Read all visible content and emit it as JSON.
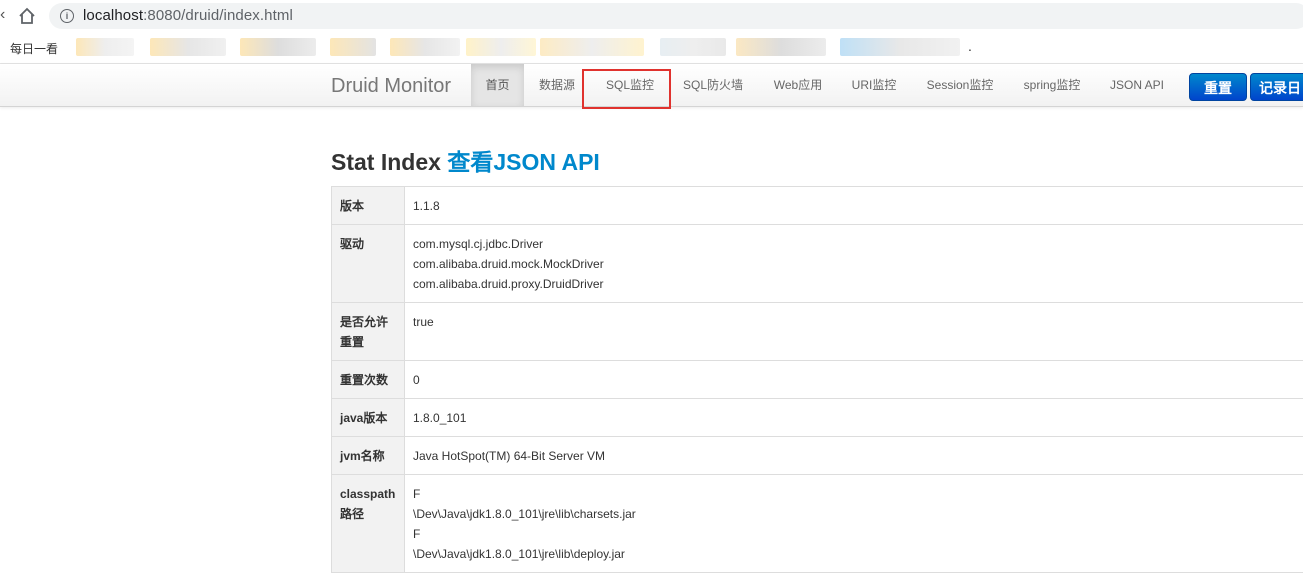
{
  "browser": {
    "url_host": "localhost",
    "url_rest": ":8080/druid/index.html",
    "bookmarks": {
      "first": "每日一看",
      "trailing": "."
    }
  },
  "navbar": {
    "brand": "Druid Monitor",
    "items": [
      {
        "label": "首页",
        "active": true
      },
      {
        "label": "数据源"
      },
      {
        "label": "SQL监控",
        "highlighted": true
      },
      {
        "label": "SQL防火墙"
      },
      {
        "label": "Web应用"
      },
      {
        "label": "URI监控"
      },
      {
        "label": "Session监控"
      },
      {
        "label": "spring监控"
      },
      {
        "label": "JSON API"
      }
    ],
    "buttons": {
      "reset": "重置",
      "log": "记录日"
    }
  },
  "page": {
    "title": "Stat Index",
    "json_link": "查看JSON API",
    "rows": [
      {
        "key": "版本",
        "values": [
          "1.1.8"
        ]
      },
      {
        "key": "驱动",
        "values": [
          "com.mysql.cj.jdbc.Driver",
          "com.alibaba.druid.mock.MockDriver",
          "com.alibaba.druid.proxy.DruidDriver"
        ]
      },
      {
        "key": "是否允许重置",
        "values": [
          "true"
        ]
      },
      {
        "key": "重置次数",
        "values": [
          "0"
        ]
      },
      {
        "key": "java版本",
        "values": [
          "1.8.0_101"
        ]
      },
      {
        "key": "jvm名称",
        "values": [
          "Java HotSpot(TM) 64-Bit Server VM"
        ]
      },
      {
        "key": "classpath路径",
        "values": [
          "F",
          "\\Dev\\Java\\jdk1.8.0_101\\jre\\lib\\charsets.jar",
          "F",
          "\\Dev\\Java\\jdk1.8.0_101\\jre\\lib\\deploy.jar"
        ]
      }
    ]
  },
  "colors": {
    "accent": "#0088cc",
    "highlight": "#e0322e",
    "primary_button": "#0055cc"
  }
}
